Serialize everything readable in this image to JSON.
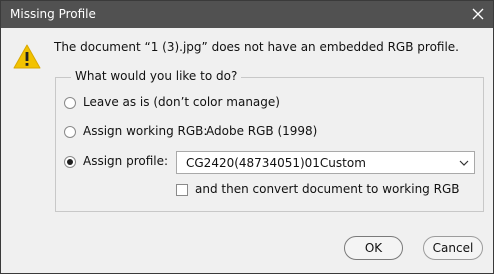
{
  "window": {
    "title": "Missing Profile"
  },
  "message": "The document “1 (3).jpg” does not have an embedded RGB profile.",
  "group": {
    "legend": "What would you like to do?"
  },
  "options": [
    {
      "label": "Leave as is (don’t color manage)",
      "checked": false
    },
    {
      "label": "Assign working RGB:",
      "value": "Adobe RGB (1998)",
      "checked": false
    },
    {
      "label": "Assign profile:",
      "checked": true
    }
  ],
  "profile_select": {
    "value": "CG2420(48734051)01Custom"
  },
  "convert_checkbox": {
    "label": "and then convert document to working RGB",
    "checked": false
  },
  "buttons": {
    "ok": "OK",
    "cancel": "Cancel"
  },
  "icons": {
    "warning": "warning-icon",
    "close": "close-icon",
    "dropdown": "chevron-down-icon"
  },
  "colors": {
    "titlebar": "#515151",
    "warning": "#f2c200"
  }
}
